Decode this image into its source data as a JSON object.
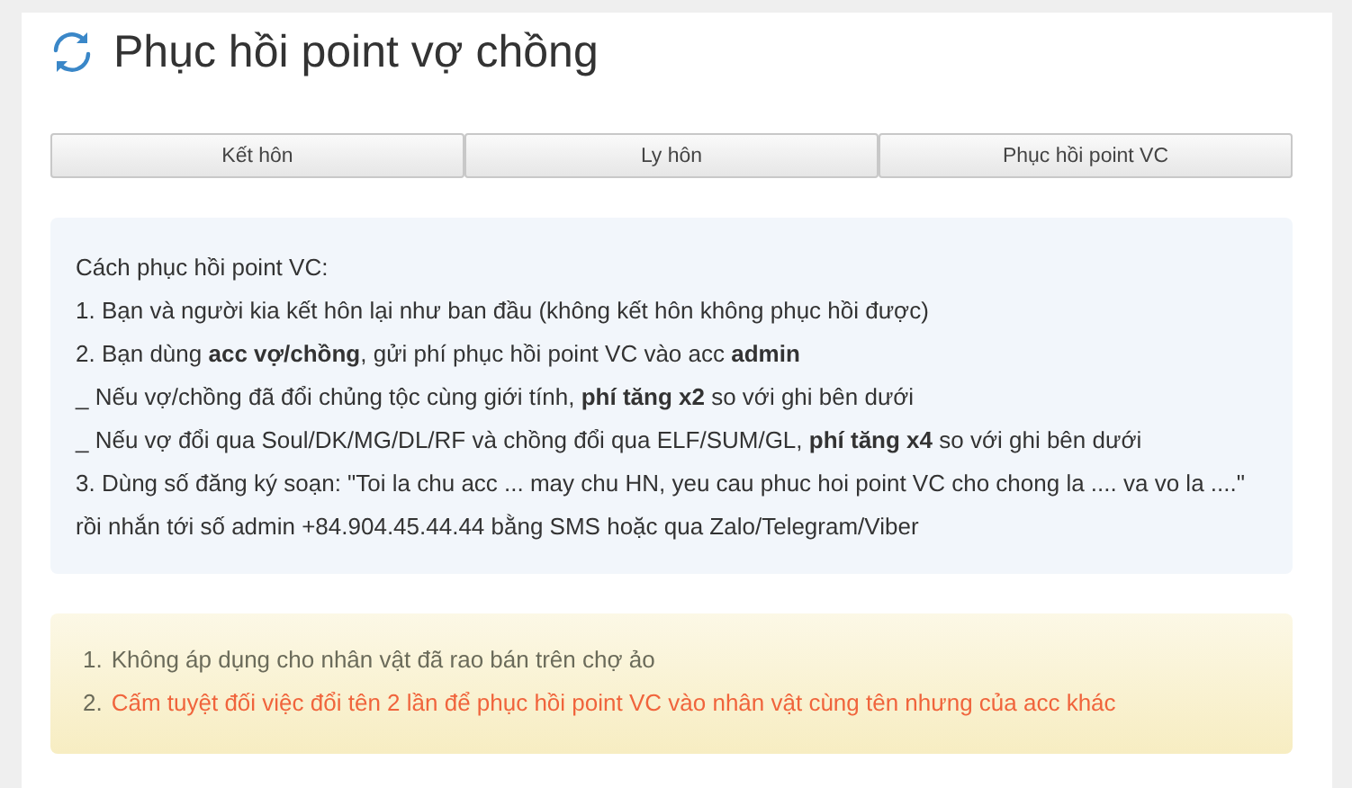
{
  "title": "Phục hồi point vợ chồng",
  "tabs": [
    {
      "label": "Kết hôn",
      "selected": false
    },
    {
      "label": "Ly hôn",
      "selected": false
    },
    {
      "label": "Phục hồi point VC",
      "selected": false
    }
  ],
  "info_lines": [
    "Cách phục hồi point VC:",
    "1. Bạn và người kia kết hôn lại như ban đầu (không kết hôn không phục hồi được)",
    "2. Bạn dùng **acc vợ/chồng**, gửi phí phục hồi point VC vào acc **admin**",
    "_ Nếu vợ/chồng đã đổi chủng tộc cùng giới tính, **phí tăng x2** so với ghi bên dưới",
    "_ Nếu vợ đổi qua Soul/DK/MG/DL/RF và chồng đổi qua ELF/SUM/GL, **phí tăng x4** so với ghi bên dưới",
    "3. Dùng số đăng ký soạn: \"Toi la chu acc ... may chu HN, yeu cau phuc hoi point VC cho chong la .... va vo la ....\"",
    "rồi nhắn tới số admin +84.904.45.44.44 bằng SMS hoặc qua Zalo/Telegram/Viber"
  ],
  "notes": [
    {
      "number": "1.",
      "text": "Không áp dụng cho nhân vật đã rao bán trên chợ ảo",
      "kind": "normal"
    },
    {
      "number": "2.",
      "text": "Cấm tuyệt đối việc đổi tên 2 lần để phục hồi point VC vào nhân vật cùng tên nhưng của acc khác",
      "kind": "danger"
    }
  ]
}
